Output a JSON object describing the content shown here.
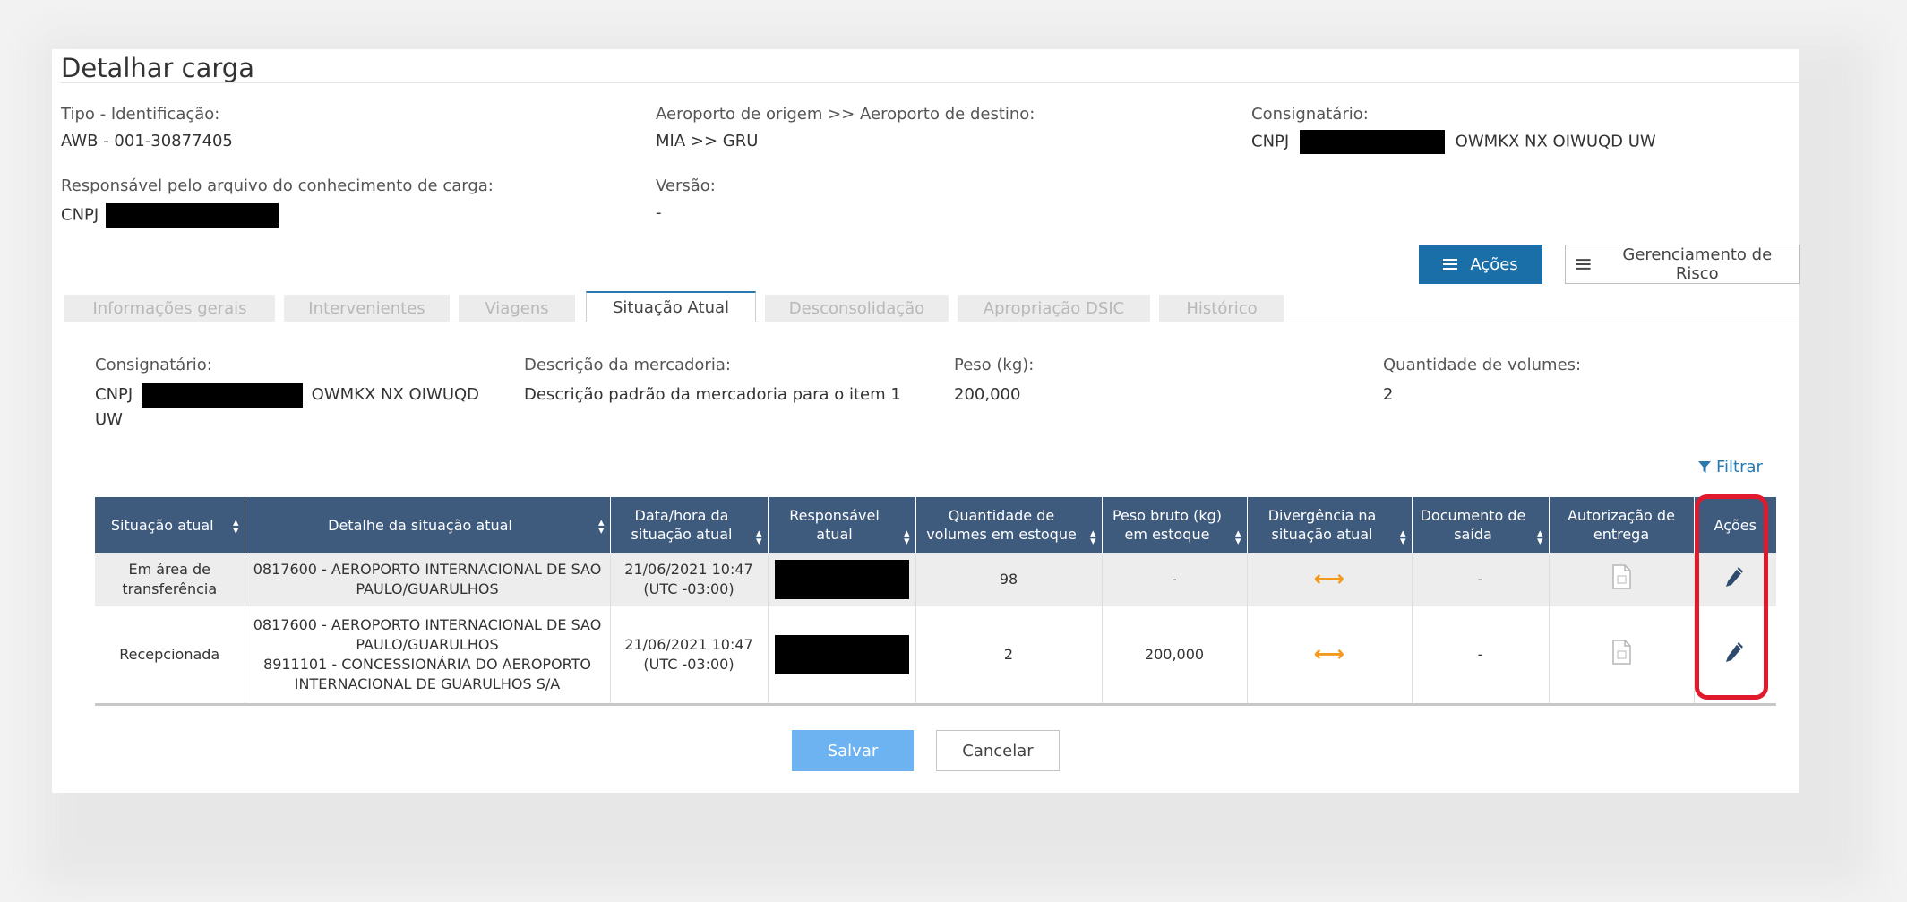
{
  "page": {
    "title": "Detalhar carga"
  },
  "info": {
    "tipo_label": "Tipo - Identificação:",
    "tipo_value": "AWB - 001-30877405",
    "aeroporto_label": "Aeroporto de origem >> Aeroporto de destino:",
    "aeroporto_value": "MIA >> GRU",
    "consignatario_label": "Consignatário:",
    "consignatario_prefix": "CNPJ",
    "consignatario_name": "OWMKX NX OIWUQD UW",
    "responsavel_label": "Responsável pelo arquivo do conhecimento de carga:",
    "responsavel_prefix": "CNPJ",
    "versao_label": "Versão:",
    "versao_value": "-"
  },
  "actions": {
    "acoes_label": "Ações",
    "risco_label": "Gerenciamento de Risco"
  },
  "tabs": [
    {
      "label": "Informações gerais",
      "active": false
    },
    {
      "label": "Intervenientes",
      "active": false
    },
    {
      "label": "Viagens",
      "active": false
    },
    {
      "label": "Situação Atual",
      "active": true
    },
    {
      "label": "Desconsolidação",
      "active": false
    },
    {
      "label": "Apropriação DSIC",
      "active": false
    },
    {
      "label": "Histórico",
      "active": false
    }
  ],
  "summary": {
    "consignatario_label": "Consignatário:",
    "consignatario_prefix": "CNPJ",
    "consignatario_name_1": "OWMKX NX OIWUQD",
    "consignatario_name_2": "UW",
    "descricao_label": "Descrição da mercadoria:",
    "descricao_value": "Descrição padrão da mercadoria para o item 1",
    "peso_label": "Peso (kg):",
    "peso_value": "200,000",
    "qtd_label": "Quantidade de volumes:",
    "qtd_value": "2"
  },
  "filter": {
    "label": "Filtrar"
  },
  "table": {
    "headers": {
      "situacao": "Situação atual",
      "detalhe": "Detalhe da situação atual",
      "data_1": "Data/hora da",
      "data_2": "situação atual",
      "resp_1": "Responsável",
      "resp_2": "atual",
      "qtd_1": "Quantidade de",
      "qtd_2": "volumes em estoque",
      "peso_1": "Peso bruto (kg)",
      "peso_2": "em estoque",
      "div_1": "Divergência na",
      "div_2": "situação atual",
      "doc_1": "Documento de",
      "doc_2": "saída",
      "aut_1": "Autorização de",
      "aut_2": "entrega",
      "acoes": "Ações"
    },
    "rows": [
      {
        "situacao_1": "Em área de",
        "situacao_2": "transferência",
        "detalhe_1": "0817600 - AEROPORTO INTERNACIONAL DE SAO",
        "detalhe_2": "PAULO/GUARULHOS",
        "detalhe_3": "",
        "detalhe_4": "",
        "data_1": "21/06/2021 10:47",
        "data_2": "(UTC -03:00)",
        "qtd": "98",
        "peso": "-",
        "doc": "-"
      },
      {
        "situacao_1": "Recepcionada",
        "situacao_2": "",
        "detalhe_1": "0817600 - AEROPORTO INTERNACIONAL DE SAO",
        "detalhe_2": "PAULO/GUARULHOS",
        "detalhe_3": "8911101 - CONCESSIONÁRIA DO AEROPORTO",
        "detalhe_4": "INTERNACIONAL DE GUARULHOS S/A",
        "data_1": "21/06/2021 10:47",
        "data_2": "(UTC -03:00)",
        "qtd": "2",
        "peso": "200,000",
        "doc": "-"
      }
    ]
  },
  "footer": {
    "salvar_label": "Salvar",
    "cancelar_label": "Cancelar"
  },
  "icons": {
    "menu": "menu-icon",
    "filter": "filter-icon",
    "sort": "sort-icon",
    "divergence": "divergence-arrow-icon",
    "document": "document-icon",
    "edit": "pencil-icon"
  },
  "colors": {
    "header_bg": "#3e5a7c",
    "primary": "#1a6fa8",
    "link": "#2a7ab0",
    "divergence": "#f39a1d",
    "highlight": "#e0192d",
    "salvar": "#6db3f2"
  }
}
